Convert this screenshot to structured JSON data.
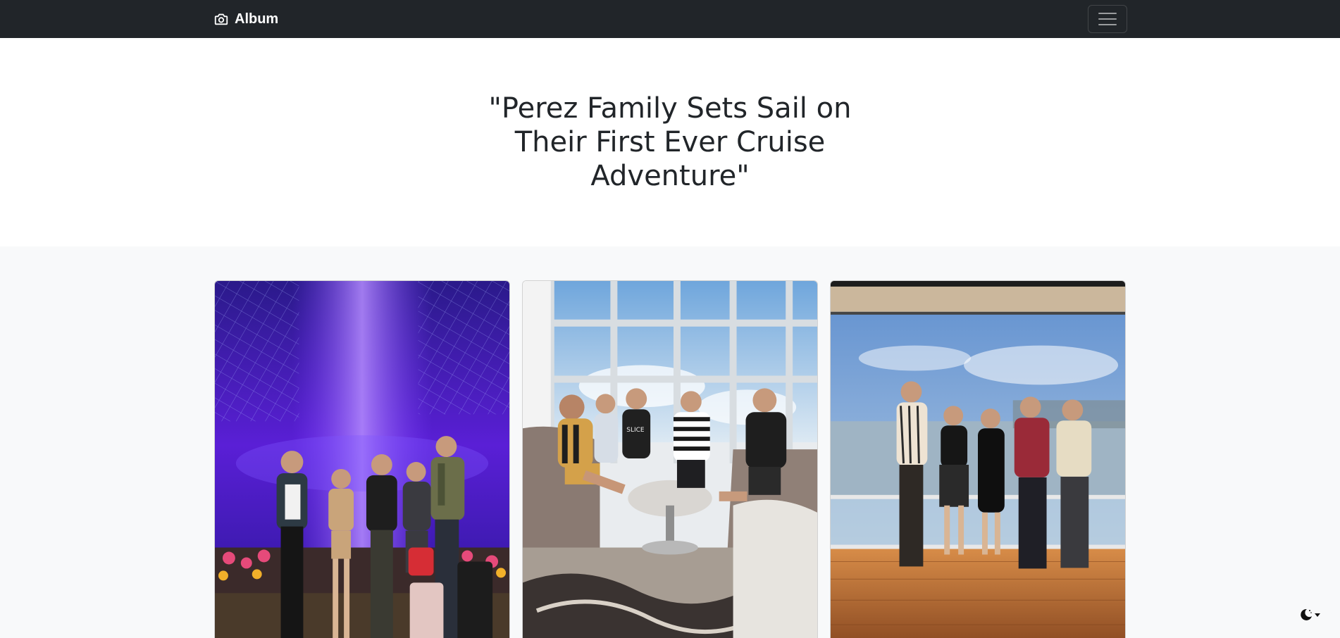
{
  "navbar": {
    "brand_label": "Album",
    "brand_icon": "camera-icon",
    "toggler_icon": "hamburger-icon"
  },
  "hero": {
    "title": "\"Perez Family Sets Sail on Their First Ever Cruise Adventure\""
  },
  "album": {
    "photos": [
      {
        "subject": "family group photo under purple waterfall lights",
        "icon": "photo-1"
      },
      {
        "subject": "family seated in ship lounge by windows",
        "icon": "photo-2"
      },
      {
        "subject": "family standing on ship deck at sunset",
        "icon": "photo-3"
      }
    ]
  },
  "theme_toggle": {
    "icon": "moon-stars-icon"
  },
  "colors": {
    "navbar_bg": "#212529",
    "album_bg": "#f8f9fa",
    "text": "#212529"
  }
}
